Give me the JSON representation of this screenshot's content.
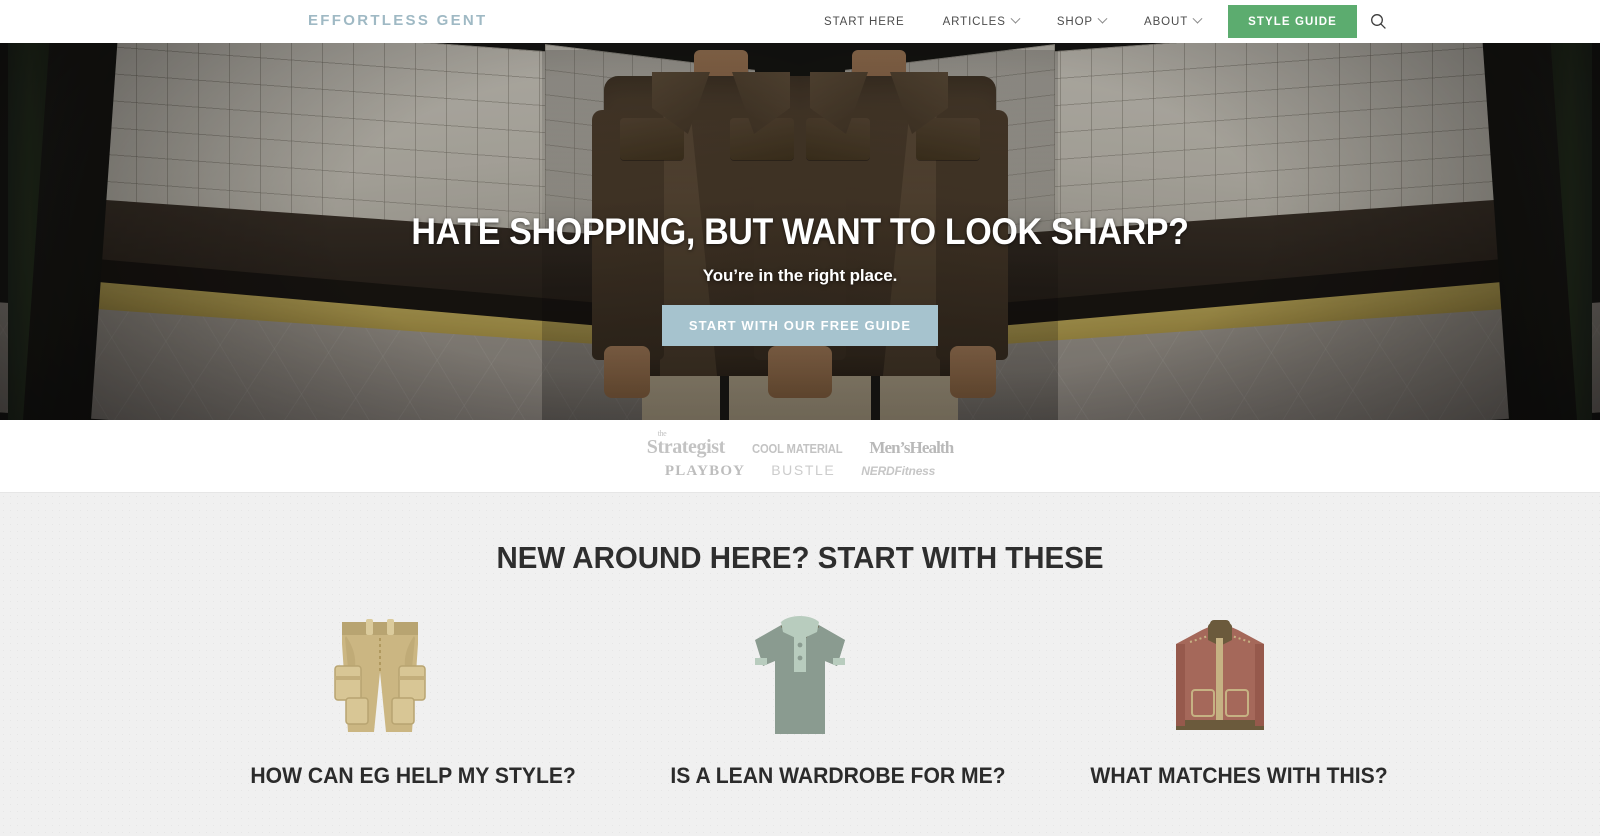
{
  "header": {
    "logo": "EFFORTLESS GENT",
    "nav": [
      {
        "label": "START HERE",
        "caret": false
      },
      {
        "label": "ARTICLES",
        "caret": true
      },
      {
        "label": "SHOP",
        "caret": true
      },
      {
        "label": "ABOUT",
        "caret": true
      }
    ],
    "cta_label": "STYLE GUIDE",
    "cta_color": "#5cac6f",
    "search_icon": "search-icon"
  },
  "hero": {
    "title": "HATE SHOPPING, BUT WANT TO LOOK SHARP?",
    "subtitle": "You’re in the right place.",
    "button_label": "START WITH OUR FREE GUIDE",
    "button_color": "#a6c3ce",
    "image_alt": "man in brown jacket on subway platform, mirrored"
  },
  "press": {
    "row1": [
      {
        "name": "the-strategist-logo",
        "the": "the",
        "text": "Strategist"
      },
      {
        "name": "cool-material-logo",
        "text": "COOL MATERIAL"
      },
      {
        "name": "mens-health-logo",
        "text": "Men’sHealth"
      }
    ],
    "row2": [
      {
        "name": "playboy-logo",
        "text": "PLAYBOY"
      },
      {
        "name": "bustle-logo",
        "text": "BUSTLE"
      },
      {
        "name": "nerd-fitness-logo",
        "text": "NERDFitness"
      }
    ]
  },
  "start_section": {
    "title": "NEW AROUND HERE? START WITH THESE",
    "background": "#f0f0f0",
    "cards": [
      {
        "title": "HOW CAN EG HELP MY STYLE?",
        "icon": "cargo-shorts-icon",
        "colors": {
          "main": "#cbb682",
          "dark": "#b8a471",
          "light": "#d8c695"
        }
      },
      {
        "title": "IS A LEAN WARDROBE FOR ME?",
        "icon": "polo-shirt-icon",
        "colors": {
          "main": "#8a9b90",
          "dark": "#7b8c81",
          "light": "#b8ccbe"
        }
      },
      {
        "title": "WHAT MATCHES WITH THIS?",
        "icon": "bomber-jacket-icon",
        "colors": {
          "main": "#a5685a",
          "dark": "#6b5a3c",
          "light": "#c6b283"
        }
      }
    ]
  }
}
